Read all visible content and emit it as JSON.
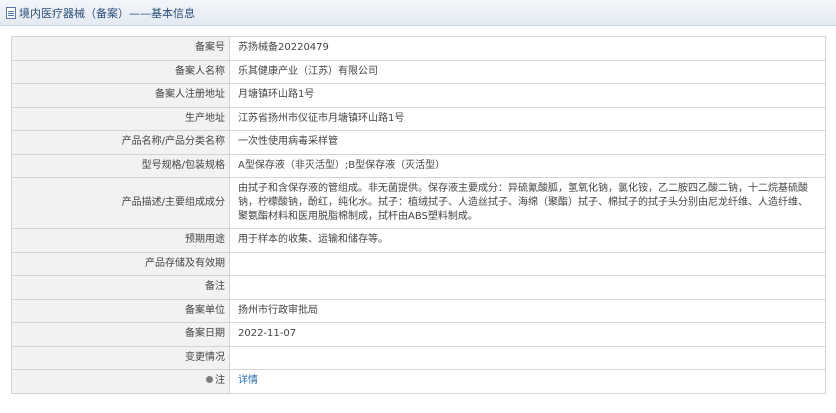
{
  "header": {
    "icon": "document-icon",
    "title": "境内医疗器械（备案）——基本信息"
  },
  "rows": [
    {
      "label": "备案号",
      "value": "苏扬械备20220479"
    },
    {
      "label": "备案人名称",
      "value": "乐其健康产业（江苏）有限公司"
    },
    {
      "label": "备案人注册地址",
      "value": "月塘镇环山路1号"
    },
    {
      "label": "生产地址",
      "value": "江苏省扬州市仪征市月塘镇环山路1号"
    },
    {
      "label": "产品名称/产品分类名称",
      "value": "一次性使用病毒采样管"
    },
    {
      "label": "型号规格/包装规格",
      "value": "A型保存液（非灭活型）;B型保存液（灭活型）"
    },
    {
      "label": "产品描述/主要组成成分",
      "value": "由拭子和含保存液的管组成。非无菌提供。保存液主要成分：异硫氰酸胍，氢氧化钠，氯化铵，乙二胺四乙酸二钠，十二烷基硫酸钠，柠檬酸钠，酚红，纯化水。拭子：植绒拭子、人造丝拭子、海绵（聚酯）拭子、棉拭子的拭子头分别由尼龙纤维、人造纤维、聚氨酯材料和医用脱脂棉制成，拭杆由ABS塑料制成。"
    },
    {
      "label": "预期用途",
      "value": "用于样本的收集、运输和储存等。"
    },
    {
      "label": "产品存储及有效期",
      "value": ""
    },
    {
      "label": "备注",
      "value": ""
    },
    {
      "label": "备案单位",
      "value": "扬州市行政审批局"
    },
    {
      "label": "备案日期",
      "value": "2022-11-07"
    },
    {
      "label": "变更情况",
      "value": ""
    }
  ],
  "note_row": {
    "icon": "bulb-icon",
    "label": "注",
    "link": "详情"
  }
}
